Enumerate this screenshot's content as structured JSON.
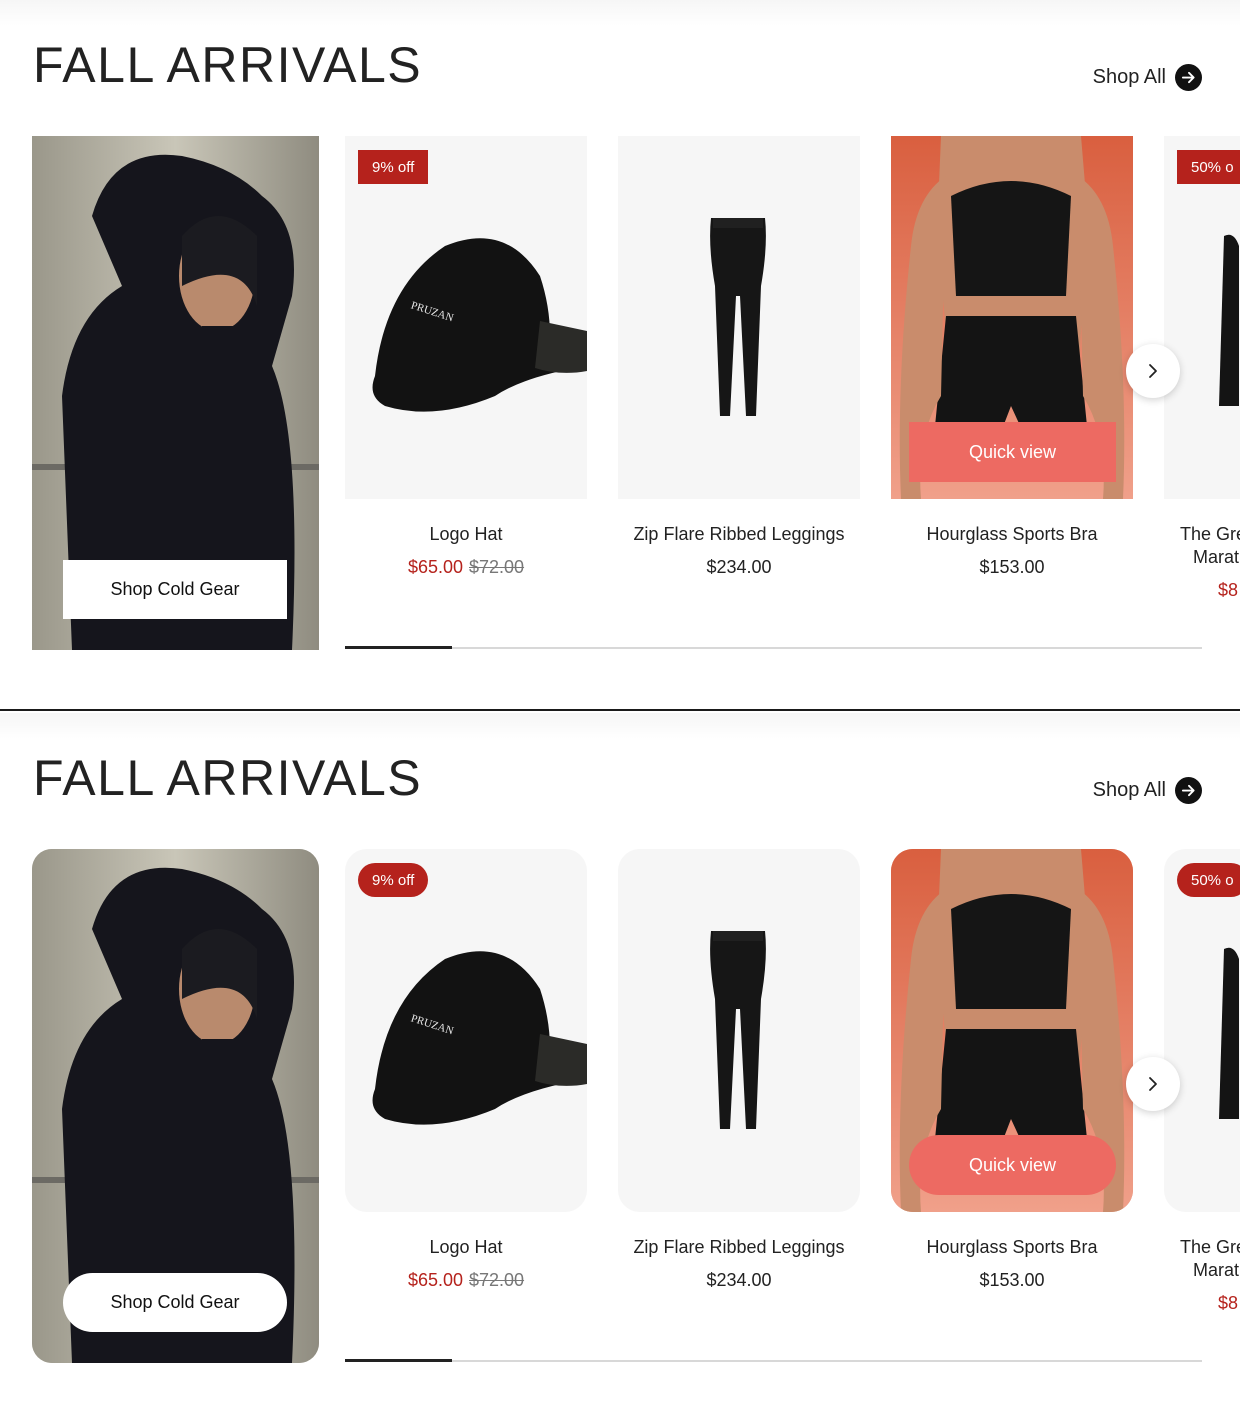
{
  "sections": [
    {
      "variant": "square",
      "title": "FALL ARRIVALS",
      "shop_all": "Shop All",
      "promo_button": "Shop Cold Gear",
      "products": [
        {
          "badge": "9% off",
          "name": "Logo Hat",
          "name2": "",
          "sale_price": "$65.00",
          "orig_price": "$72.00",
          "price": ""
        },
        {
          "badge": "",
          "name": "Zip Flare Ribbed Leggings",
          "name2": "",
          "sale_price": "",
          "orig_price": "",
          "price": "$234.00"
        },
        {
          "badge": "",
          "name": "Hourglass Sports Bra",
          "name2": "",
          "sale_price": "",
          "orig_price": "",
          "price": "$153.00",
          "quick_view": "Quick view"
        },
        {
          "badge": "50% o",
          "name": "The Gre",
          "name2": "Marat",
          "sale_price": "$8",
          "orig_price": "",
          "price": ""
        }
      ],
      "progress": 0.125
    },
    {
      "variant": "rounded",
      "title": "FALL ARRIVALS",
      "shop_all": "Shop All",
      "promo_button": "Shop Cold Gear",
      "products": [
        {
          "badge": "9% off",
          "name": "Logo Hat",
          "name2": "",
          "sale_price": "$65.00",
          "orig_price": "$72.00",
          "price": ""
        },
        {
          "badge": "",
          "name": "Zip Flare Ribbed Leggings",
          "name2": "",
          "sale_price": "",
          "orig_price": "",
          "price": "$234.00"
        },
        {
          "badge": "",
          "name": "Hourglass Sports Bra",
          "name2": "",
          "sale_price": "",
          "orig_price": "",
          "price": "$153.00",
          "quick_view": "Quick view"
        },
        {
          "badge": "50% o",
          "name": "The Gre",
          "name2": "Marat",
          "sale_price": "$8",
          "orig_price": "",
          "price": ""
        }
      ],
      "progress": 0.125
    }
  ],
  "hat_logo_text": "PRUZAN",
  "colors": {
    "sale": "#b5221c",
    "quick_view": "#ed6a62",
    "text": "#222222"
  }
}
